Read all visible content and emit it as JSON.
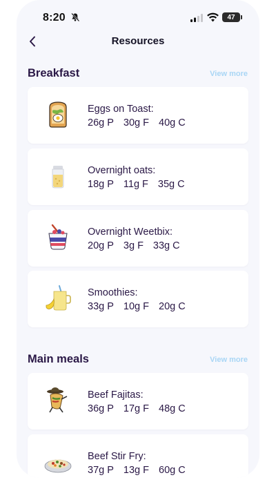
{
  "status_bar": {
    "time": "8:20",
    "battery": "47"
  },
  "header": {
    "title": "Resources"
  },
  "sections": [
    {
      "title": "Breakfast",
      "view_more": "View more",
      "items": [
        {
          "name": "Eggs on Toast:",
          "protein": "26g P",
          "fat": "30g F",
          "carbs": "40g C",
          "icon": "eggs-on-toast-icon"
        },
        {
          "name": "Overnight oats:",
          "protein": "18g P",
          "fat": "11g F",
          "carbs": "35g C",
          "icon": "overnight-oats-icon"
        },
        {
          "name": "Overnight Weetbix:",
          "protein": "20g P",
          "fat": "3g F",
          "carbs": "33g C",
          "icon": "parfait-icon"
        },
        {
          "name": "Smoothies:",
          "protein": "33g P",
          "fat": "10g F",
          "carbs": "20g C",
          "icon": "smoothie-icon"
        }
      ]
    },
    {
      "title": "Main meals",
      "view_more": "View more",
      "items": [
        {
          "name": "Beef Fajitas:",
          "protein": "36g P",
          "fat": "17g F",
          "carbs": "48g C",
          "icon": "fajita-icon"
        },
        {
          "name": "Beef Stir Fry:",
          "protein": "37g P",
          "fat": "13g F",
          "carbs": "60g C",
          "icon": "stir-fry-icon"
        }
      ]
    }
  ]
}
